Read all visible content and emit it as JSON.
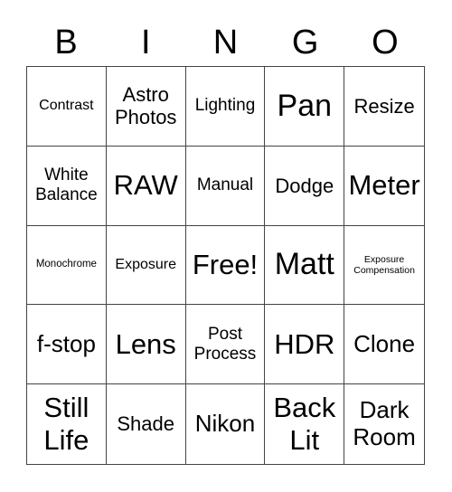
{
  "header": [
    "B",
    "I",
    "N",
    "G",
    "O"
  ],
  "cells": [
    {
      "text": "Contrast",
      "size": "s16"
    },
    {
      "text": "Astro Photos",
      "size": "s22"
    },
    {
      "text": "Lighting",
      "size": "s19"
    },
    {
      "text": "Pan",
      "size": "s34"
    },
    {
      "text": "Resize",
      "size": "s22"
    },
    {
      "text": "White Balance",
      "size": "s19"
    },
    {
      "text": "RAW",
      "size": "s30"
    },
    {
      "text": "Manual",
      "size": "s19"
    },
    {
      "text": "Dodge",
      "size": "s22"
    },
    {
      "text": "Meter",
      "size": "s30"
    },
    {
      "text": "Monochrome",
      "size": "s11"
    },
    {
      "text": "Exposure",
      "size": "s16"
    },
    {
      "text": "Free!",
      "size": "s30"
    },
    {
      "text": "Matt",
      "size": "s34"
    },
    {
      "text": "Exposure Compensation",
      "size": "s10"
    },
    {
      "text": "f-stop",
      "size": "s26"
    },
    {
      "text": "Lens",
      "size": "s30"
    },
    {
      "text": "Post Process",
      "size": "s19"
    },
    {
      "text": "HDR",
      "size": "s30"
    },
    {
      "text": "Clone",
      "size": "s26"
    },
    {
      "text": "Still Life",
      "size": "s30"
    },
    {
      "text": "Shade",
      "size": "s22"
    },
    {
      "text": "Nikon",
      "size": "s26"
    },
    {
      "text": "Back Lit",
      "size": "s30"
    },
    {
      "text": "Dark Room",
      "size": "s26"
    }
  ]
}
